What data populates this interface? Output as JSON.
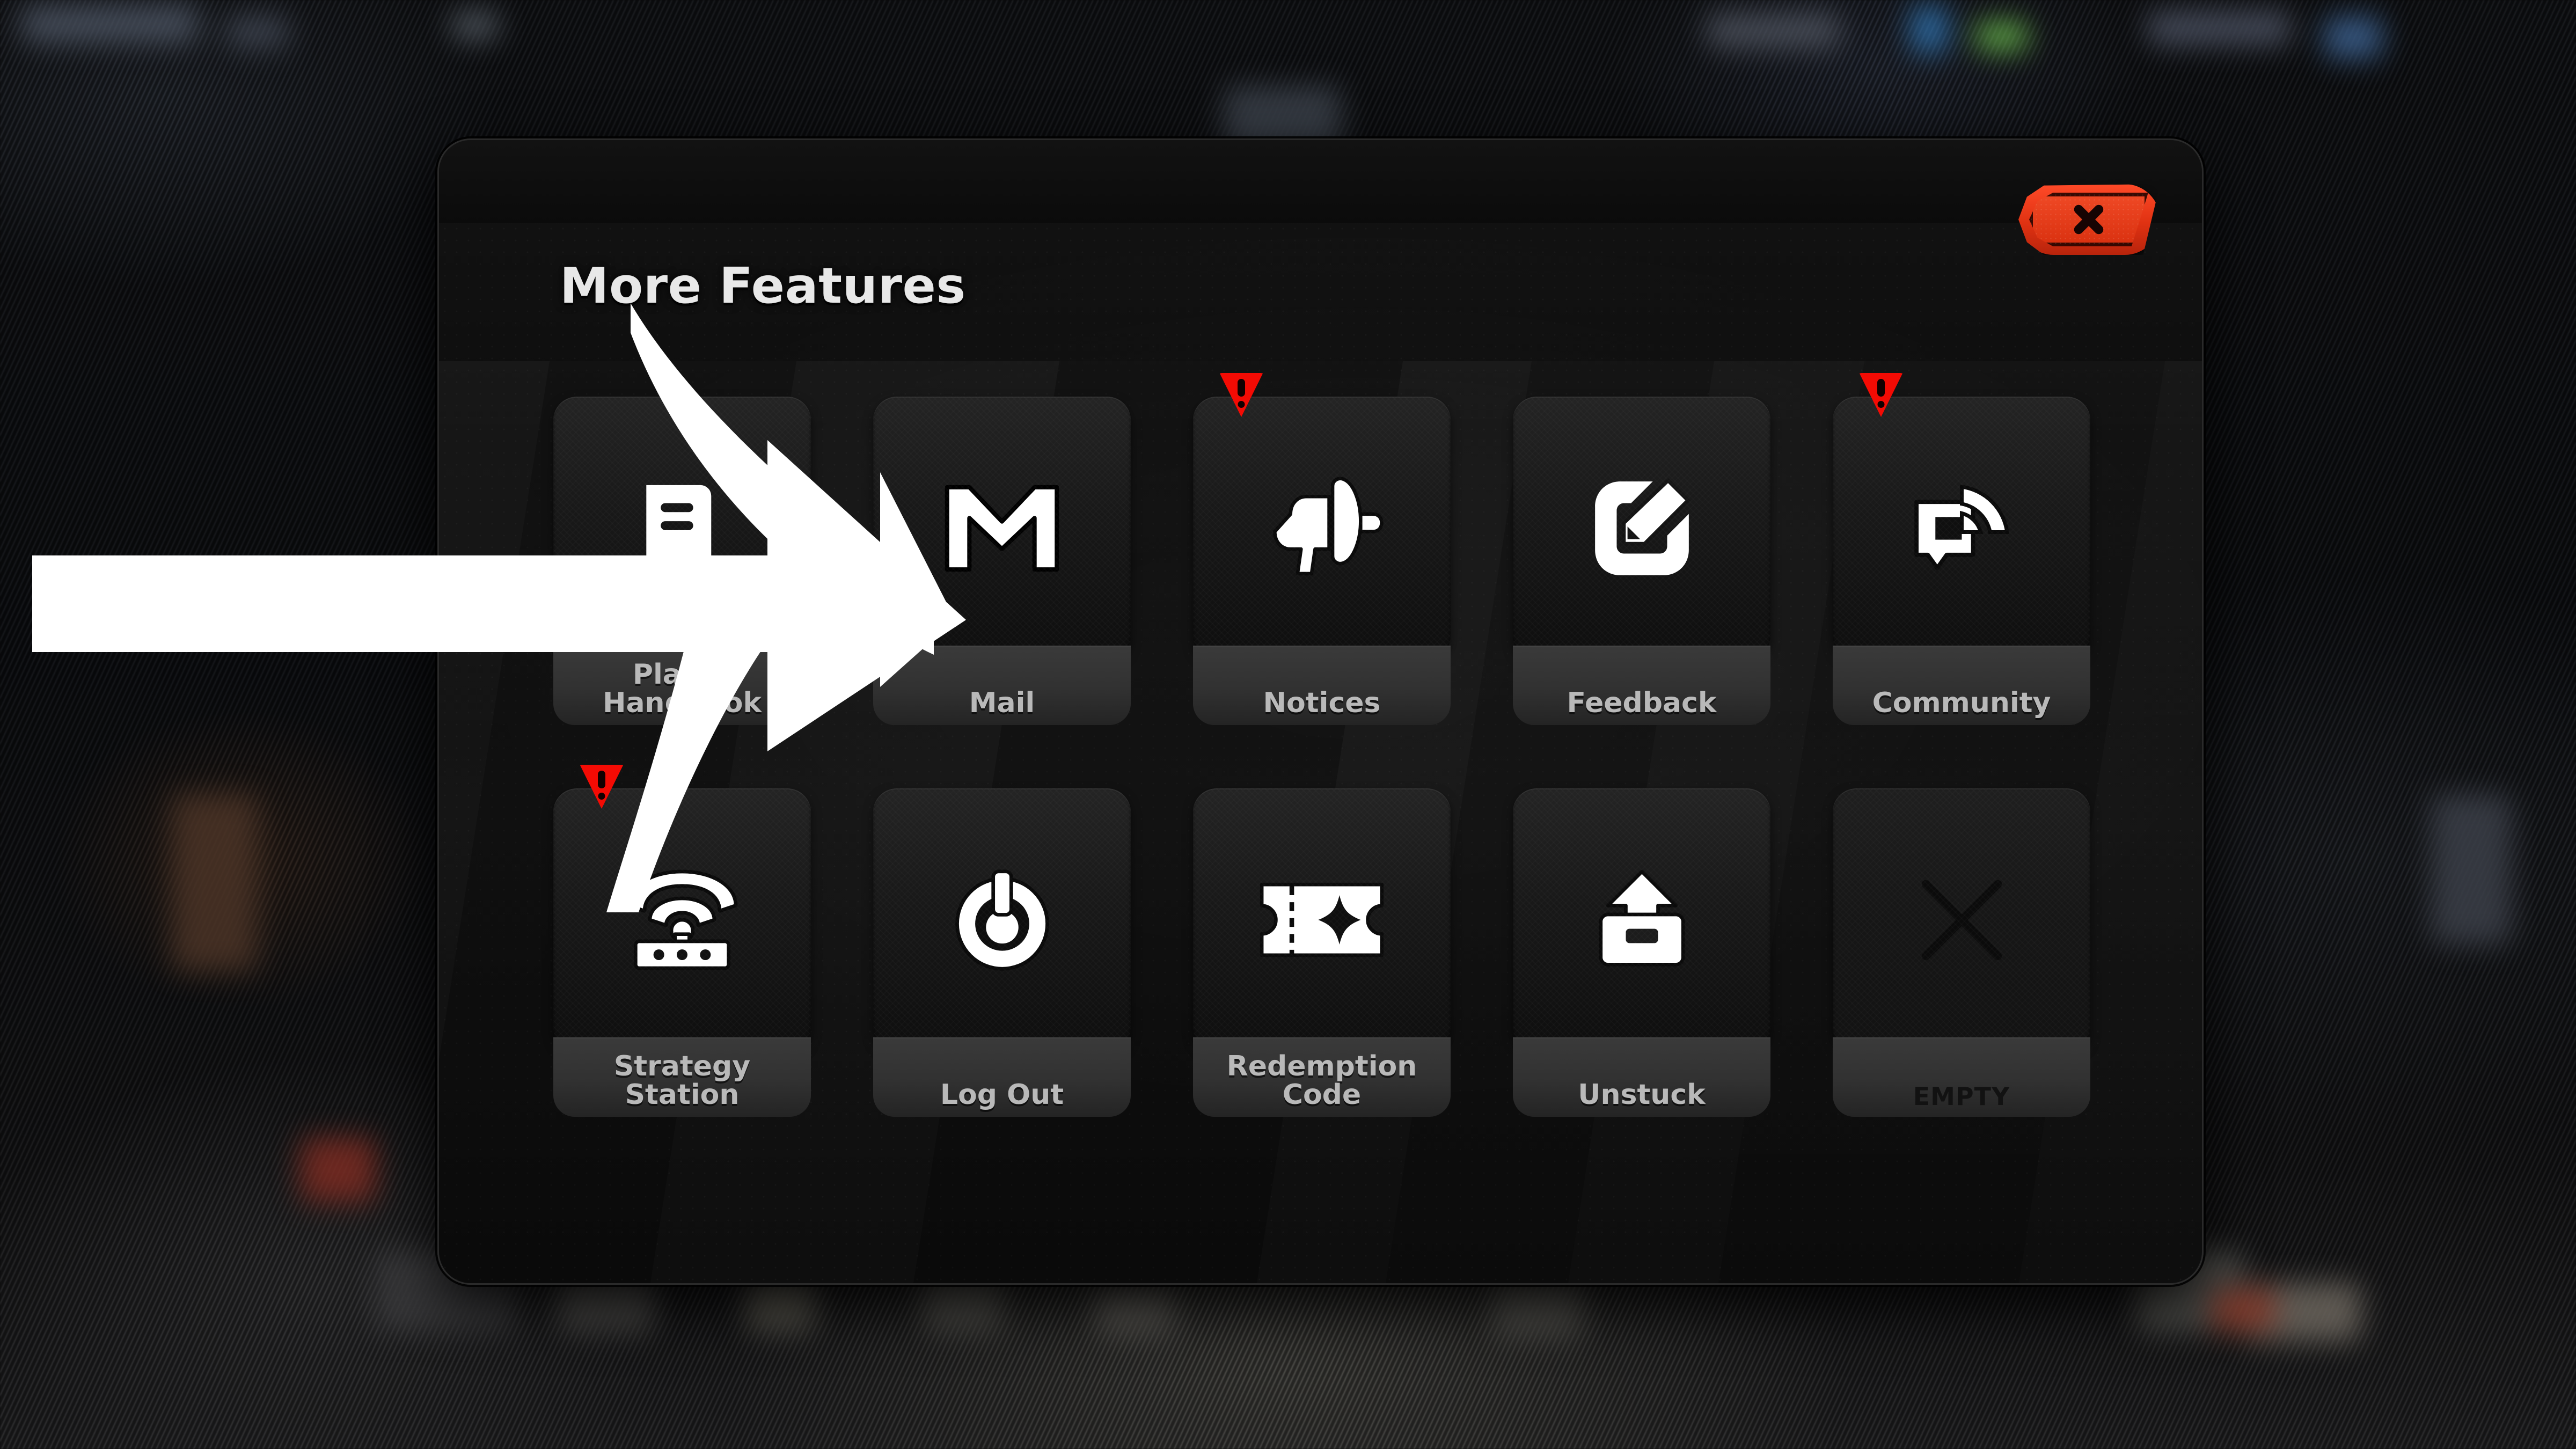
{
  "panel": {
    "title": "More Features",
    "close_button": {
      "label": "X",
      "icon": "close-x-icon",
      "color": "#e03212"
    }
  },
  "badge": {
    "icon": "alert-triangle-icon",
    "glyph": "!",
    "color": "#f40b04"
  },
  "tiles": [
    {
      "label": "Player\nHandbook",
      "icon": "book-icon",
      "badge": false,
      "empty": false,
      "row": 1
    },
    {
      "label": "Mail",
      "icon": "mail-m-icon",
      "badge": false,
      "empty": false,
      "row": 1
    },
    {
      "label": "Notices",
      "icon": "megaphone-icon",
      "badge": true,
      "empty": false,
      "row": 1
    },
    {
      "label": "Feedback",
      "icon": "edit-pencil-icon",
      "badge": false,
      "empty": false,
      "row": 1
    },
    {
      "label": "Community",
      "icon": "broadcast-chat-icon",
      "badge": true,
      "empty": false,
      "row": 1
    },
    {
      "label": "Strategy\nStation",
      "icon": "wifi-router-icon",
      "badge": true,
      "empty": false,
      "row": 2
    },
    {
      "label": "Log Out",
      "icon": "power-icon",
      "badge": false,
      "empty": false,
      "row": 2
    },
    {
      "label": "Redemption\nCode",
      "icon": "ticket-star-icon",
      "badge": false,
      "empty": false,
      "row": 2
    },
    {
      "label": "Unstuck",
      "icon": "eject-upload-icon",
      "badge": false,
      "empty": false,
      "row": 2
    },
    {
      "label": "EMPTY",
      "icon": "x-cross-icon",
      "badge": false,
      "empty": true,
      "row": 2
    }
  ],
  "annotation": {
    "icon": "pointer-arrow-icon",
    "color": "#ffffff",
    "points_to": "Mail"
  }
}
